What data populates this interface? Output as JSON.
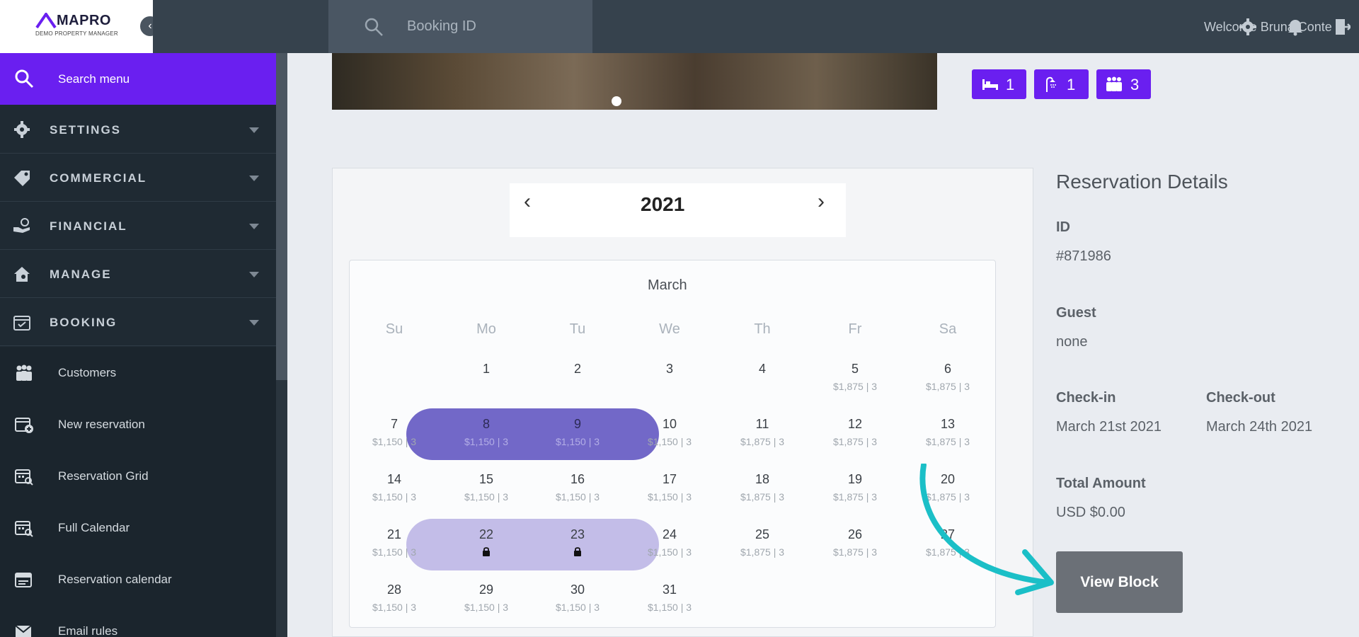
{
  "brand": {
    "name": "MAPRO",
    "subtitle": "DEMO PROPERTY MANAGER",
    "accent": "#6a1ff0"
  },
  "sidebar": {
    "search_label": "Search menu",
    "sections": [
      {
        "label": "SETTINGS",
        "icon": "gear-icon"
      },
      {
        "label": "COMMERCIAL",
        "icon": "tag-icon"
      },
      {
        "label": "FINANCIAL",
        "icon": "hand-coin-icon"
      },
      {
        "label": "MANAGE",
        "icon": "house-gear-icon"
      },
      {
        "label": "BOOKING",
        "icon": "calendar-check-icon"
      }
    ],
    "booking_items": [
      {
        "label": "Customers",
        "icon": "people-icon"
      },
      {
        "label": "New reservation",
        "icon": "calendar-plus-icon"
      },
      {
        "label": "Reservation Grid",
        "icon": "calendar-search-icon"
      },
      {
        "label": "Full Calendar",
        "icon": "calendar-search-icon"
      },
      {
        "label": "Reservation calendar",
        "icon": "calendar-icon"
      },
      {
        "label": "Email rules",
        "icon": "envelope-icon"
      }
    ]
  },
  "topbar": {
    "search_placeholder": "Booking ID",
    "welcome": "Welcome Bruna Conte"
  },
  "room_badges": [
    {
      "icon": "bed-icon",
      "count": "1"
    },
    {
      "icon": "shower-icon",
      "count": "1"
    },
    {
      "icon": "people-icon",
      "count": "3"
    }
  ],
  "calendar": {
    "year": "2021",
    "month": "March",
    "weekdays": [
      "Su",
      "Mo",
      "Tu",
      "We",
      "Th",
      "Fr",
      "Sa"
    ],
    "weeks": [
      [
        null,
        {
          "d": "1",
          "p": ""
        },
        {
          "d": "2",
          "p": ""
        },
        {
          "d": "3",
          "p": ""
        },
        {
          "d": "4",
          "p": ""
        },
        {
          "d": "5",
          "p": "$1,875 | 3"
        },
        {
          "d": "6",
          "p": "$1,875 | 3"
        }
      ],
      [
        {
          "d": "7",
          "p": "$1,150 | 3"
        },
        {
          "d": "8",
          "p": "$1,150 | 3"
        },
        {
          "d": "9",
          "p": "$1,150 | 3"
        },
        {
          "d": "10",
          "p": "$1,150 | 3"
        },
        {
          "d": "11",
          "p": "$1,875 | 3"
        },
        {
          "d": "12",
          "p": "$1,875 | 3"
        },
        {
          "d": "13",
          "p": "$1,875 | 3"
        }
      ],
      [
        {
          "d": "14",
          "p": "$1,150 | 3"
        },
        {
          "d": "15",
          "p": "$1,150 | 3"
        },
        {
          "d": "16",
          "p": "$1,150 | 3"
        },
        {
          "d": "17",
          "p": "$1,150 | 3"
        },
        {
          "d": "18",
          "p": "$1,875 | 3"
        },
        {
          "d": "19",
          "p": "$1,875 | 3"
        },
        {
          "d": "20",
          "p": "$1,875 | 3"
        }
      ],
      [
        {
          "d": "21",
          "p": "$1,150 | 3"
        },
        {
          "d": "22",
          "p": "",
          "lock": true
        },
        {
          "d": "23",
          "p": "",
          "lock": true
        },
        {
          "d": "24",
          "p": "$1,150 | 3"
        },
        {
          "d": "25",
          "p": "$1,875 | 3"
        },
        {
          "d": "26",
          "p": "$1,875 | 3"
        },
        {
          "d": "27",
          "p": "$1,875 | 3"
        }
      ],
      [
        {
          "d": "28",
          "p": "$1,150 | 3"
        },
        {
          "d": "29",
          "p": "$1,150 | 3"
        },
        {
          "d": "30",
          "p": "$1,150 | 3"
        },
        {
          "d": "31",
          "p": "$1,150 | 3"
        },
        null,
        null,
        null
      ]
    ],
    "highlight_colors": {
      "booked": "#7268c8",
      "blocked": "#c3bde8"
    }
  },
  "reservation": {
    "title": "Reservation Details",
    "id_label": "ID",
    "id_value": "#871986",
    "guest_label": "Guest",
    "guest_value": "none",
    "checkin_label": "Check-in",
    "checkin_value": "March 21st 2021",
    "checkout_label": "Check-out",
    "checkout_value": "March 24th 2021",
    "total_label": "Total Amount",
    "total_value": "USD $0.00",
    "view_block_label": "View Block"
  }
}
